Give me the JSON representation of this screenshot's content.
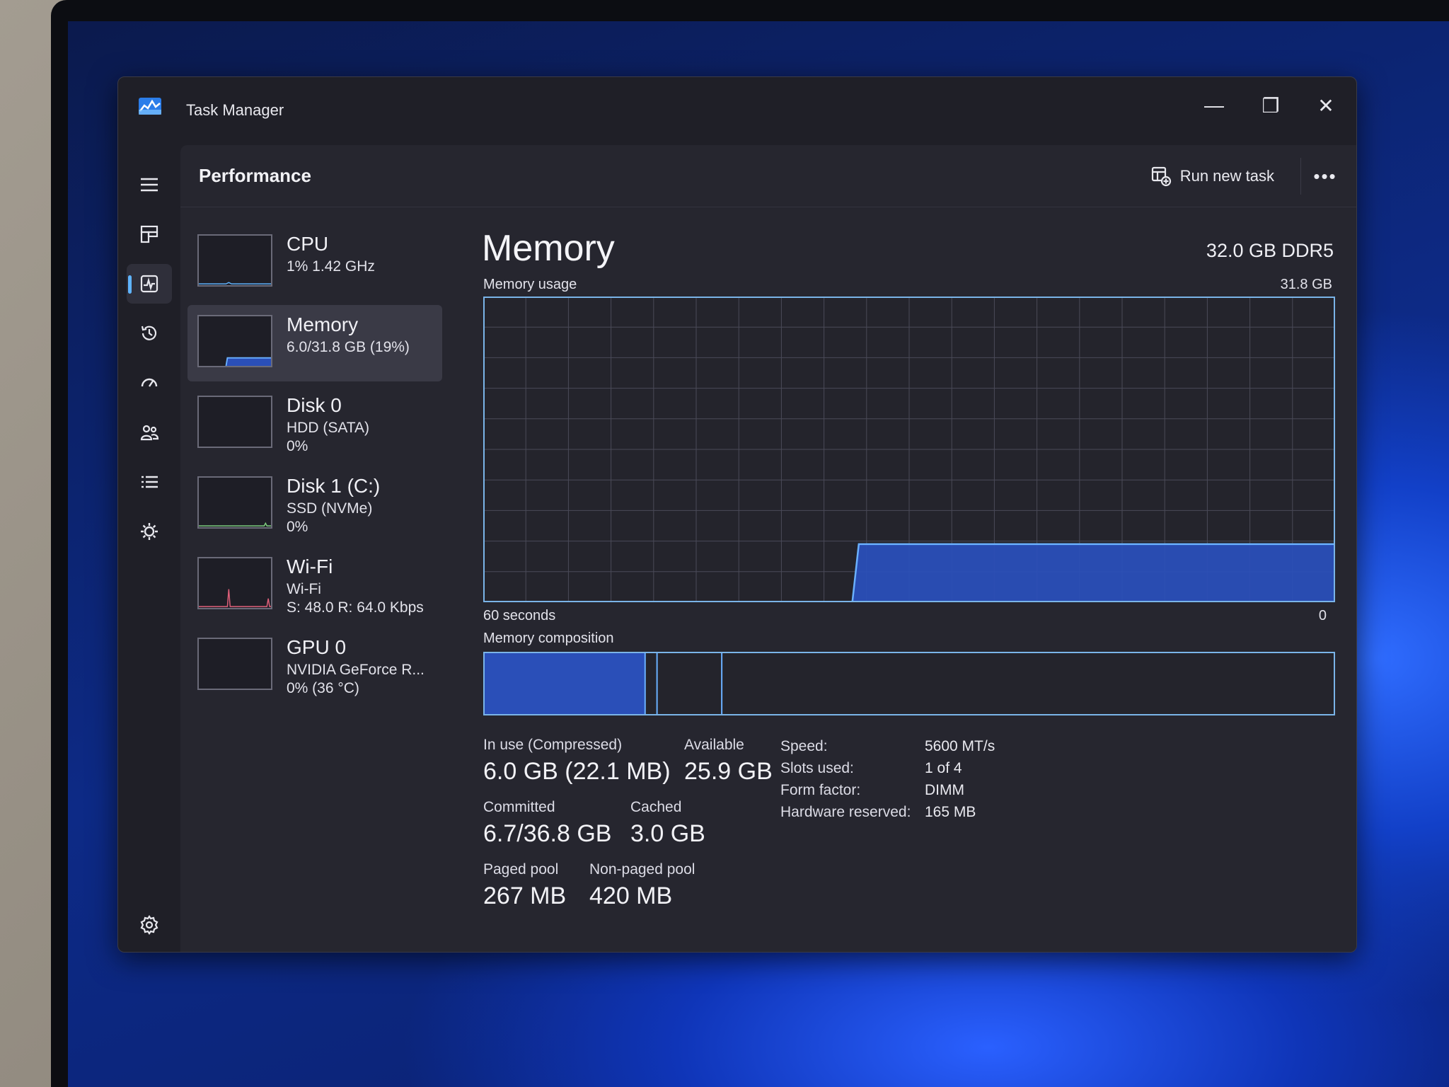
{
  "window": {
    "title": "Task Manager",
    "minimize_glyph": "—",
    "maximize_glyph": "❐",
    "close_glyph": "✕"
  },
  "header": {
    "page_title": "Performance",
    "run_task_label": "Run new task",
    "more_glyph": "•••"
  },
  "rail": {
    "items": [
      {
        "icon": "hamburger-icon"
      },
      {
        "icon": "processes-icon"
      },
      {
        "icon": "performance-icon",
        "active": true
      },
      {
        "icon": "app-history-icon"
      },
      {
        "icon": "startup-apps-icon"
      },
      {
        "icon": "users-icon"
      },
      {
        "icon": "details-icon"
      },
      {
        "icon": "services-icon"
      },
      {
        "icon": "settings-icon"
      }
    ]
  },
  "devices": [
    {
      "name": "CPU",
      "line1": "1% 1.42 GHz",
      "line2": ""
    },
    {
      "name": "Memory",
      "line1": "6.0/31.8 GB (19%)",
      "line2": ""
    },
    {
      "name": "Disk 0",
      "line1": "HDD (SATA)",
      "line2": "0%"
    },
    {
      "name": "Disk 1 (C:)",
      "line1": "SSD (NVMe)",
      "line2": "0%"
    },
    {
      "name": "Wi-Fi",
      "line1": "Wi-Fi",
      "line2": "S: 48.0  R: 64.0 Kbps"
    },
    {
      "name": "GPU 0",
      "line1": "NVIDIA GeForce R...",
      "line2": "0% (36 °C)"
    }
  ],
  "memory": {
    "title": "Memory",
    "spec": "32.0 GB DDR5",
    "usage_label": "Memory usage",
    "usage_max": "31.8 GB",
    "time_label": "60 seconds",
    "time_zero": "0",
    "composition_label": "Memory composition",
    "usage_series_fraction": [
      0,
      0,
      0,
      0,
      0,
      0,
      0,
      0,
      0,
      0,
      0,
      0,
      0,
      0,
      0,
      0,
      0,
      0,
      0,
      0,
      0,
      0,
      0,
      0,
      0,
      0,
      0.19,
      0.19,
      0.19,
      0.19,
      0.19,
      0.19,
      0.19,
      0.19,
      0.19,
      0.19,
      0.19,
      0.19,
      0.19,
      0.19,
      0.19,
      0.19,
      0.19,
      0.19,
      0.19,
      0.19,
      0.19,
      0.19,
      0.19,
      0.19,
      0.19,
      0.19,
      0.19,
      0.19,
      0.19,
      0.19,
      0.19,
      0.19,
      0.19,
      0.19
    ],
    "composition_fraction": {
      "in_use": 0.19,
      "modified": 0.014,
      "standby": 0.076
    }
  },
  "stats": {
    "in_use_label": "In use (Compressed)",
    "in_use_value": "6.0 GB (22.1 MB)",
    "available_label": "Available",
    "available_value": "25.9 GB",
    "committed_label": "Committed",
    "committed_value": "6.7/36.8 GB",
    "cached_label": "Cached",
    "cached_value": "3.0 GB",
    "paged_label": "Paged pool",
    "paged_value": "267 MB",
    "nonpaged_label": "Non-paged pool",
    "nonpaged_value": "420 MB"
  },
  "specs": [
    {
      "label": "Speed:",
      "value": "5600 MT/s"
    },
    {
      "label": "Slots used:",
      "value": "1 of 4"
    },
    {
      "label": "Form factor:",
      "value": "DIMM"
    },
    {
      "label": "Hardware reserved:",
      "value": "165 MB"
    }
  ],
  "colors": {
    "accent": "#5fb4ff",
    "memory_fill": "#2a4fb8",
    "memory_line": "#6ab0ff",
    "grid": "#4a4a58"
  }
}
